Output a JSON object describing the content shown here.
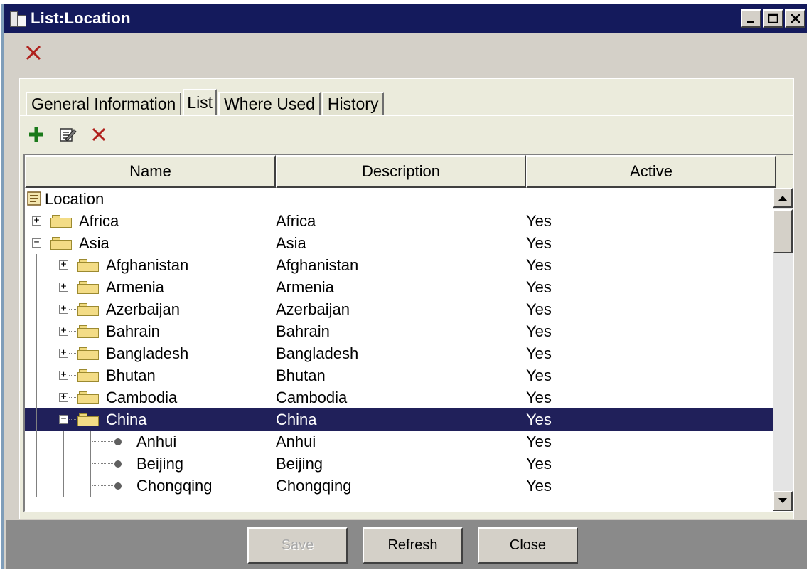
{
  "window": {
    "title": "List:Location",
    "icon": "building-icon",
    "controls": [
      "minimize-icon",
      "maximize-icon",
      "close-icon"
    ]
  },
  "main_toolbar": {
    "delete_icon": "red-x-icon"
  },
  "tabs": [
    {
      "label": "General Information",
      "active": false
    },
    {
      "label": "List",
      "active": true
    },
    {
      "label": "Where Used",
      "active": false
    },
    {
      "label": "History",
      "active": false
    }
  ],
  "list_toolbar": {
    "icons": [
      "add-plus-icon",
      "edit-icon",
      "delete-x-icon"
    ]
  },
  "grid": {
    "columns": [
      "Name",
      "Description",
      "Active"
    ],
    "rows": [
      {
        "name": "Location",
        "description": "",
        "active": "",
        "level": 0,
        "type": "root"
      },
      {
        "name": "Africa",
        "description": "Africa",
        "active": "Yes",
        "level": 1,
        "type": "folder",
        "expanded": false
      },
      {
        "name": "Asia",
        "description": "Asia",
        "active": "Yes",
        "level": 1,
        "type": "folder",
        "expanded": true
      },
      {
        "name": "Afghanistan",
        "description": "Afghanistan",
        "active": "Yes",
        "level": 2,
        "type": "folder",
        "expanded": false
      },
      {
        "name": "Armenia",
        "description": "Armenia",
        "active": "Yes",
        "level": 2,
        "type": "folder",
        "expanded": false
      },
      {
        "name": "Azerbaijan",
        "description": "Azerbaijan",
        "active": "Yes",
        "level": 2,
        "type": "folder",
        "expanded": false
      },
      {
        "name": "Bahrain",
        "description": "Bahrain",
        "active": "Yes",
        "level": 2,
        "type": "folder",
        "expanded": false
      },
      {
        "name": "Bangladesh",
        "description": "Bangladesh",
        "active": "Yes",
        "level": 2,
        "type": "folder",
        "expanded": false
      },
      {
        "name": "Bhutan",
        "description": "Bhutan",
        "active": "Yes",
        "level": 2,
        "type": "folder",
        "expanded": false
      },
      {
        "name": "Cambodia",
        "description": "Cambodia",
        "active": "Yes",
        "level": 2,
        "type": "folder",
        "expanded": false
      },
      {
        "name": "China",
        "description": "China",
        "active": "Yes",
        "level": 2,
        "type": "folder",
        "expanded": true,
        "selected": true
      },
      {
        "name": "Anhui",
        "description": "Anhui",
        "active": "Yes",
        "level": 3,
        "type": "leaf"
      },
      {
        "name": "Beijing",
        "description": "Beijing",
        "active": "Yes",
        "level": 3,
        "type": "leaf"
      },
      {
        "name": "Chongqing",
        "description": "Chongqing",
        "active": "Yes",
        "level": 3,
        "type": "leaf"
      }
    ]
  },
  "footer": {
    "save_label": "Save",
    "save_enabled": false,
    "refresh_label": "Refresh",
    "close_label": "Close"
  },
  "colors": {
    "title_bar": "#141a5c",
    "selection": "#20205a",
    "panel": "#ebebdc",
    "footer": "#8a8a8a"
  }
}
